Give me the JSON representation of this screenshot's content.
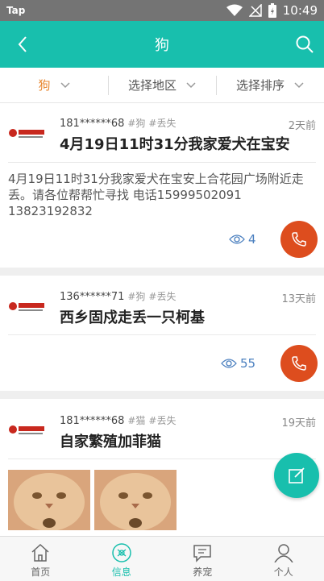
{
  "status_bar": {
    "app": "Tap",
    "time": "10:49"
  },
  "header": {
    "title": "狗"
  },
  "filters": [
    {
      "label": "狗",
      "active": true
    },
    {
      "label": "选择地区",
      "active": false
    },
    {
      "label": "选择排序",
      "active": false
    }
  ],
  "posts": [
    {
      "user": "181******68",
      "tags": [
        "#狗",
        "#丢失"
      ],
      "time": "2天前",
      "title": "4月19日11时31分我家爱犬在宝安",
      "description": "4月19日11时31分我家爱犬在宝安上合花园广场附近走丢。请各位帮帮忙寻找 电话15999502091 13823192832",
      "views": "4"
    },
    {
      "user": "136******71",
      "tags": [
        "#狗",
        "#丢失"
      ],
      "time": "13天前",
      "title": "西乡固戍走丢一只柯基",
      "views": "55"
    },
    {
      "user": "181******68",
      "tags": [
        "#猫",
        "#丢失"
      ],
      "time": "19天前",
      "title": "自家繁殖加菲猫"
    }
  ],
  "tabbar": [
    {
      "label": "首页",
      "icon": "home-icon",
      "active": false
    },
    {
      "label": "信息",
      "icon": "info-icon",
      "active": true
    },
    {
      "label": "养宠",
      "icon": "chat-icon",
      "active": false
    },
    {
      "label": "个人",
      "icon": "person-icon",
      "active": false
    }
  ],
  "colors": {
    "accent": "#18bfad",
    "call": "#dd4d1e",
    "active_filter": "#e8862f"
  }
}
